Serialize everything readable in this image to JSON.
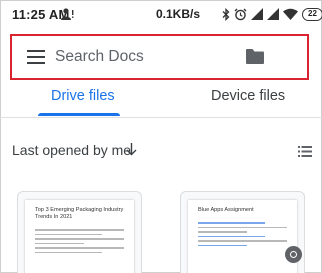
{
  "status_bar": {
    "time": "11:25 AM",
    "net_speed": "0.1KB/s",
    "battery": "22"
  },
  "search": {
    "placeholder": "Search Docs"
  },
  "tabs": [
    {
      "label": "Drive files",
      "active": true
    },
    {
      "label": "Device files",
      "active": false
    }
  ],
  "section": {
    "title": "Last opened by me"
  },
  "documents": [
    {
      "title": "Top 3 Emerging Packaging Industry Trends In 2021"
    },
    {
      "title": "Blue Apps Assignment"
    }
  ],
  "colors": {
    "accent": "#1a73e8",
    "highlight_border": "#d9232e"
  },
  "icons": [
    "person-icon",
    "bluetooth-icon",
    "alarm-icon",
    "signal-icon",
    "wifi-icon",
    "battery-icon",
    "menu-icon",
    "folder-icon",
    "arrow-down-icon",
    "list-view-icon"
  ]
}
